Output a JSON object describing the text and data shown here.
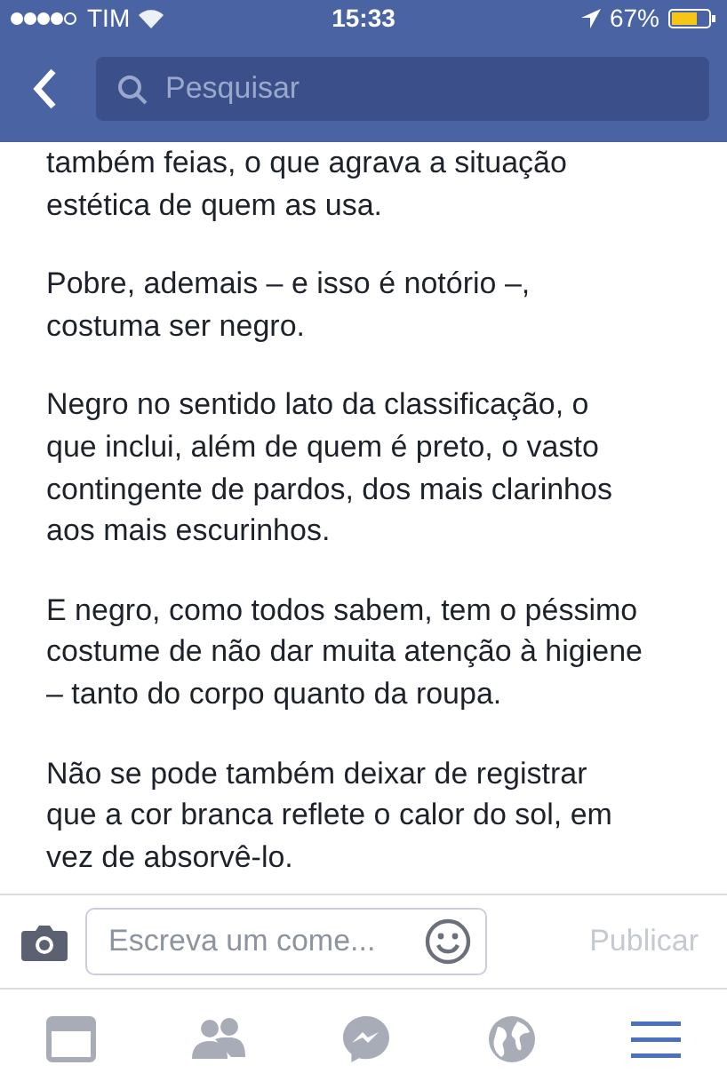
{
  "status_bar": {
    "carrier": "TIM",
    "time": "15:33",
    "battery": "67%"
  },
  "nav_bar": {
    "search": {
      "placeholder": "Pesquisar"
    }
  },
  "post": {
    "paragraphs": [
      "também feias, o que agrava a situação\nestética de quem as usa.",
      "Pobre, ademais – e isso é notório –,\ncostuma ser negro.",
      "Negro no sentido lato da classificação, o\nque inclui, além de quem é preto, o vasto\ncontingente de pardos, dos mais clarinhos\naos mais escurinhos.",
      "E negro, como todos sabem, tem o péssimo\ncostume de não dar muita atenção à higiene\n– tanto do corpo quanto da roupa.",
      "Não se pode também deixar de registrar\nque a cor branca reflete o calor do sol, em\nvez de absorvê-lo."
    ]
  },
  "comment_bar": {
    "placeholder": "Escreva um come...",
    "publish": "Publicar"
  },
  "tab_bar": [
    {
      "kind": "feed",
      "selected": false
    },
    {
      "kind": "friends",
      "selected": false
    },
    {
      "kind": "messenger",
      "selected": false
    },
    {
      "kind": "globe",
      "selected": false
    },
    {
      "kind": "menu",
      "selected": true
    }
  ]
}
